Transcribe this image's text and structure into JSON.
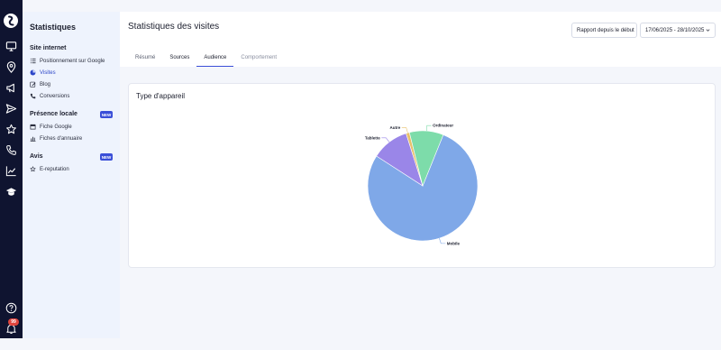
{
  "sidebar": {
    "title": "Statistiques",
    "sections": {
      "site": "Site internet",
      "local": "Présence locale",
      "avis": "Avis"
    },
    "new_badge": "NEW",
    "items": {
      "positionnement": "Positionnement sur Google",
      "visites": "Visites",
      "blog": "Blog",
      "conversions": "Conversions",
      "fiche_google": "Fiche Google",
      "fiches_annuaire": "Fiches d'annuaire",
      "ereputation": "E-reputation"
    }
  },
  "rail": {
    "notification_count": "99"
  },
  "header": {
    "title": "Statistiques des visites",
    "report_button": "Rapport depuis le début",
    "date_range": "17/06/2025 - 28/10/2025",
    "tabs": {
      "resume": "Résumé",
      "sources": "Sources",
      "audience": "Audience",
      "comportement": "Comportement"
    }
  },
  "card": {
    "title": "Type d'appareil"
  },
  "chart_data": {
    "type": "pie",
    "title": "Type d'appareil",
    "slices": [
      {
        "label": "Mobile",
        "value": 78,
        "color": "#7fa8e8"
      },
      {
        "label": "Tablette",
        "value": 11,
        "color": "#9a86e8"
      },
      {
        "label": "Autre",
        "value": 1,
        "color": "#e8c06a"
      },
      {
        "label": "Ordinateur",
        "value": 10,
        "color": "#7ddcaa"
      }
    ]
  }
}
